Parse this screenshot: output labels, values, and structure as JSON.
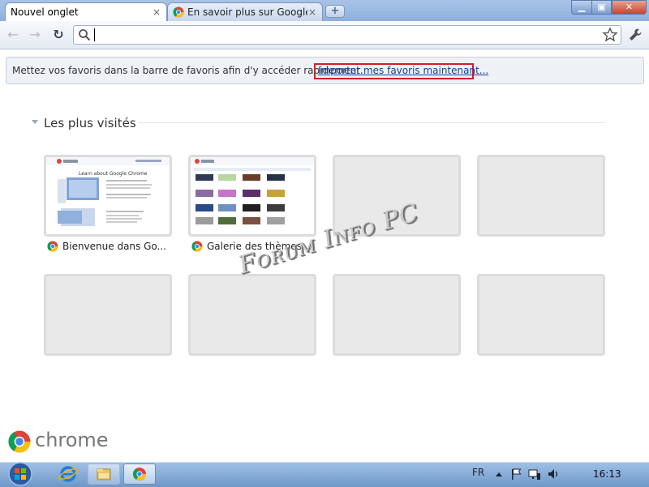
{
  "tabs": [
    {
      "label": "Nouvel onglet",
      "close": "×",
      "active": true
    },
    {
      "label": "En savoir plus sur Google...",
      "close": "×",
      "active": false
    }
  ],
  "new_tab_label": "+",
  "window_controls": {
    "minimize": "▁",
    "maximize": "▣",
    "close": "✕"
  },
  "nav": {
    "back": "←",
    "forward": "→",
    "reload": "↻"
  },
  "omnibox": {
    "value": ""
  },
  "infobar": {
    "message": "Mettez vos favoris dans la barre de favoris afin d'y accéder rapidement.",
    "link": "Importer mes favoris maintenant..."
  },
  "most_visited": {
    "title": "Les plus visités",
    "thumbnails": [
      {
        "label": "Bienvenue dans Go...",
        "filled": true,
        "preview_heading": "Learn about Google Chrome"
      },
      {
        "label": "Galerie des thèmes...",
        "filled": true,
        "preview_heading": ""
      },
      {
        "label": "",
        "filled": false
      },
      {
        "label": "",
        "filled": false
      },
      {
        "label": "",
        "filled": false
      },
      {
        "label": "",
        "filled": false
      },
      {
        "label": "",
        "filled": false
      },
      {
        "label": "",
        "filled": false
      }
    ]
  },
  "watermark": "Forum Info PC",
  "brand": {
    "wordmark": "chrome"
  },
  "taskbar": {
    "language": "FR",
    "time": "16:13"
  },
  "colors": {
    "highlight_box": "#d21e26",
    "link": "#1a3e9b",
    "titlebar": "#a9c3e6"
  }
}
